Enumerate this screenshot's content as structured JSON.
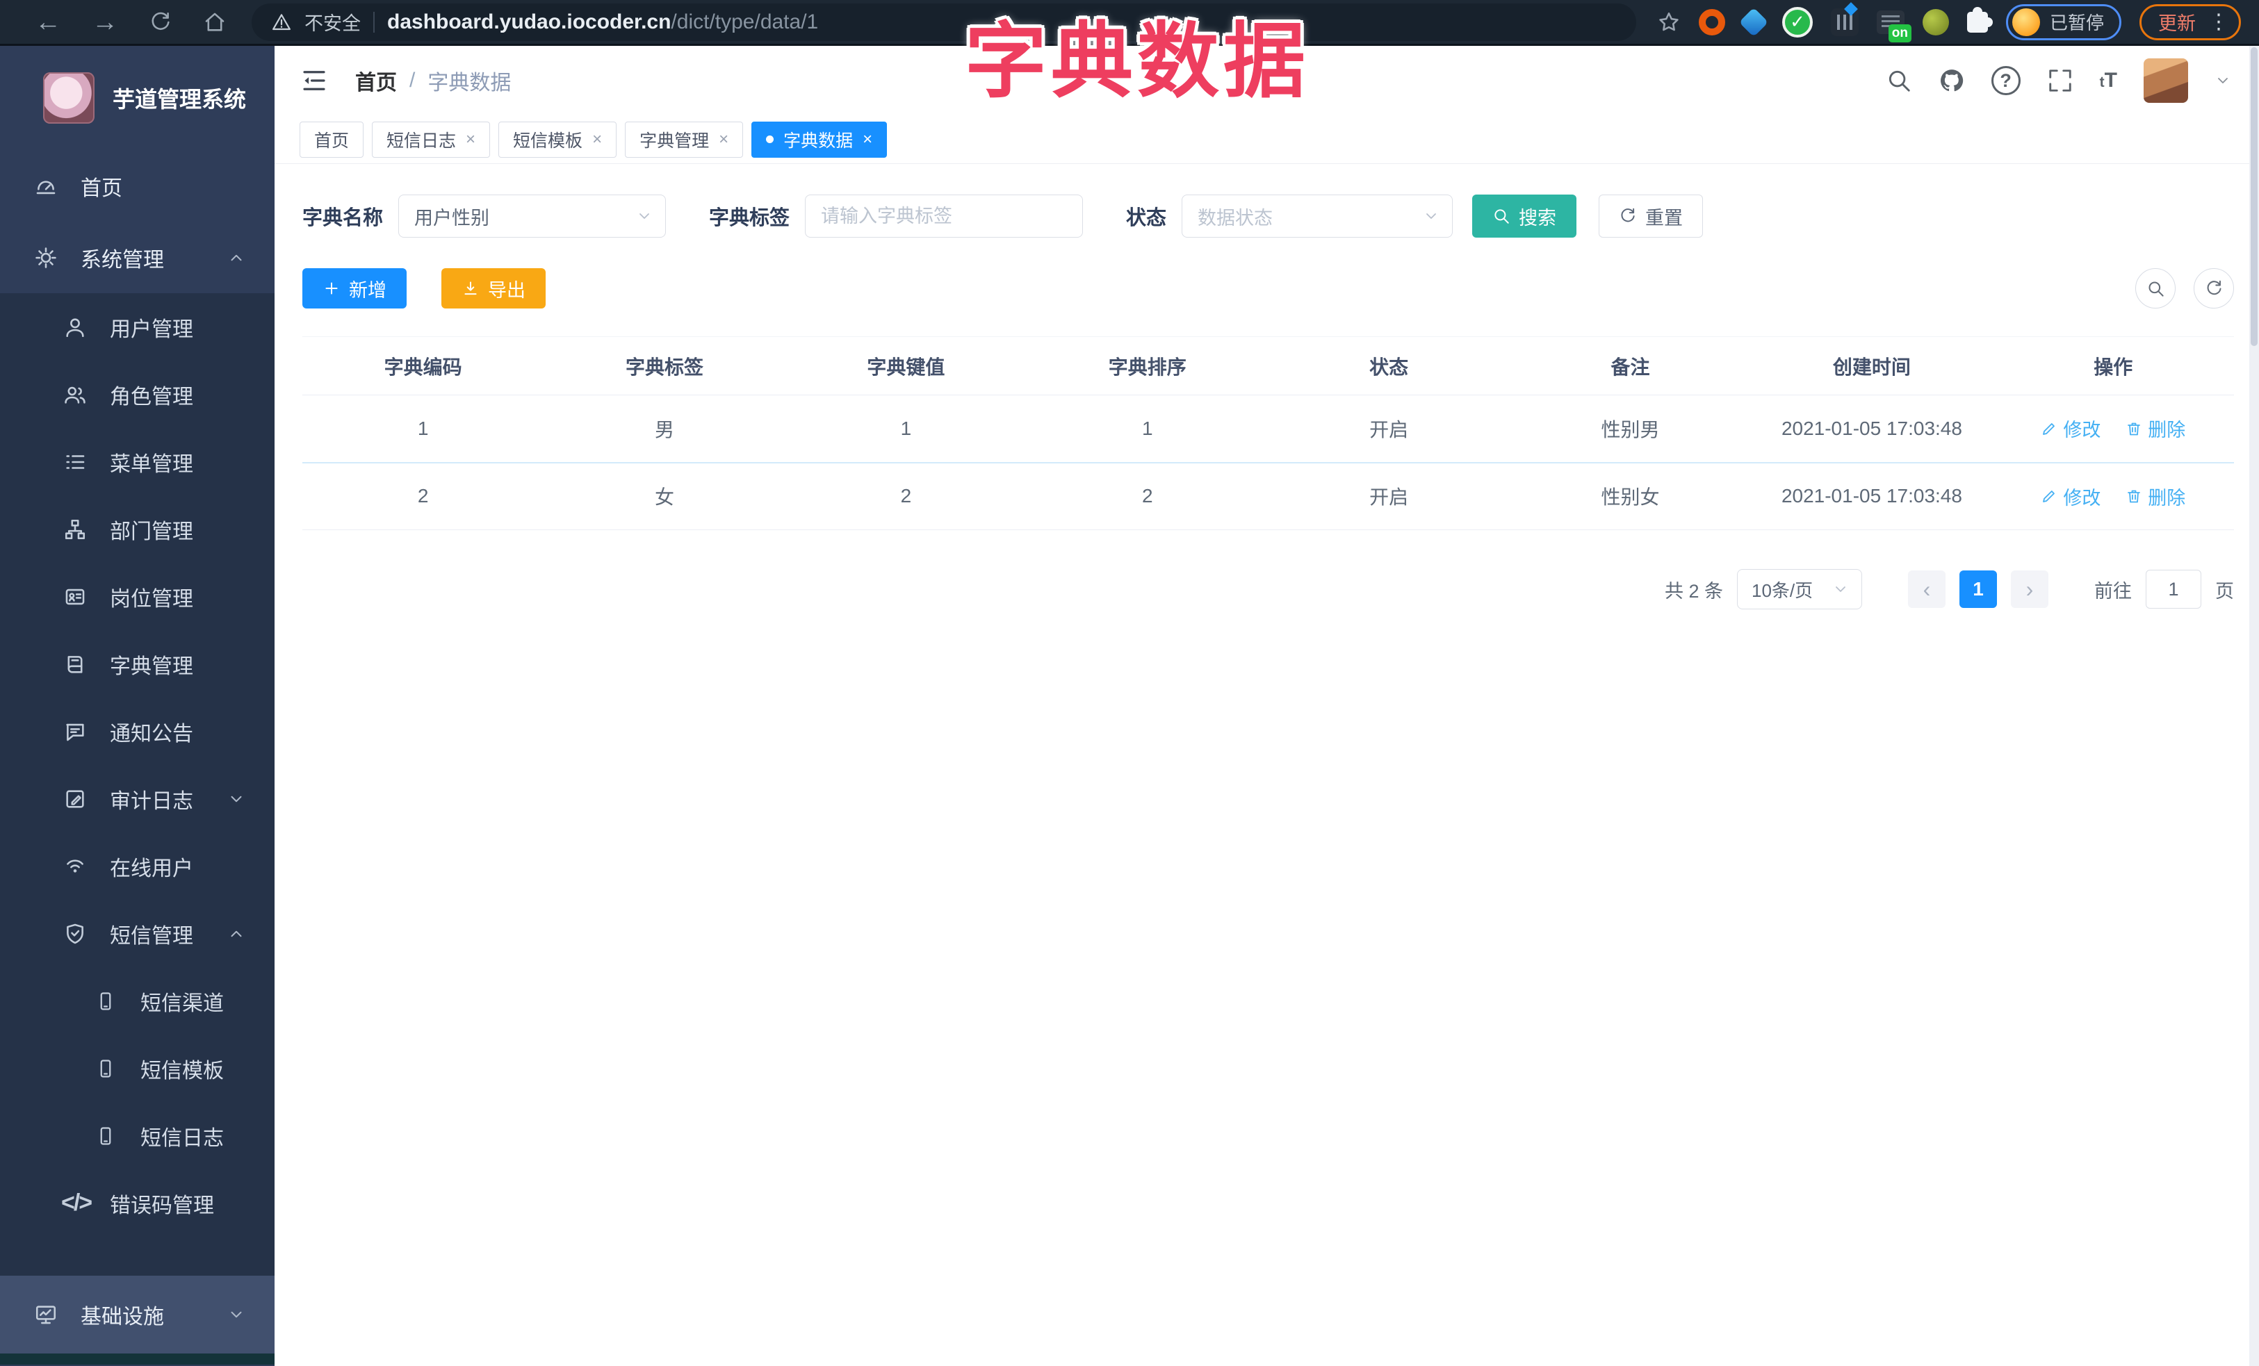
{
  "colors": {
    "accent": "#1890ff",
    "success_teal": "#2db5a3",
    "warning_yellow": "#f9a814",
    "overlay_pink": "#ee3e5f",
    "sidebar_bg": "#2f3d59",
    "submenu_bg": "#253248"
  },
  "overlay_title": "字典数据",
  "browser": {
    "security_chip": "不安全",
    "url_domain": "dashboard.yudao.iocoder.cn",
    "url_path": "/dict/type/data/1",
    "on_badge": "on",
    "paused_badge": "已暂停",
    "update_button": "更新"
  },
  "icons": {
    "back": "←",
    "forward": "→",
    "close": "×",
    "question": "?",
    "code": "</>",
    "check": "✓",
    "kebab": "⋮",
    "prev": "‹",
    "next": "›",
    "caret": "▾",
    "star": "☆",
    "warning": "⚠",
    "font_large": "T",
    "font_small": "t"
  },
  "sidebar": {
    "app_title": "芋道管理系统",
    "items": [
      {
        "label": "首页"
      },
      {
        "label": "系统管理"
      },
      {
        "label": "用户管理"
      },
      {
        "label": "角色管理"
      },
      {
        "label": "菜单管理"
      },
      {
        "label": "部门管理"
      },
      {
        "label": "岗位管理"
      },
      {
        "label": "字典管理"
      },
      {
        "label": "通知公告"
      },
      {
        "label": "审计日志"
      },
      {
        "label": "在线用户"
      },
      {
        "label": "短信管理"
      },
      {
        "label": "短信渠道"
      },
      {
        "label": "短信模板"
      },
      {
        "label": "短信日志"
      },
      {
        "label": "错误码管理"
      },
      {
        "label": "基础设施"
      }
    ]
  },
  "navbar": {
    "breadcrumb_home": "首页",
    "breadcrumb_sep": "/",
    "breadcrumb_current": "字典数据"
  },
  "tabs": [
    {
      "label": "首页"
    },
    {
      "label": "短信日志"
    },
    {
      "label": "短信模板"
    },
    {
      "label": "字典管理"
    },
    {
      "label": "字典数据"
    }
  ],
  "filter": {
    "dict_name_label": "字典名称",
    "dict_name_value": "用户性别",
    "dict_label_label": "字典标签",
    "dict_label_placeholder": "请输入字典标签",
    "status_label": "状态",
    "status_placeholder": "数据状态",
    "search_button": "搜索",
    "reset_button": "重置"
  },
  "toolbar": {
    "add_button": "新增",
    "export_button": "导出"
  },
  "table": {
    "headers": [
      "字典编码",
      "字典标签",
      "字典键值",
      "字典排序",
      "状态",
      "备注",
      "创建时间",
      "操作"
    ],
    "rows": [
      {
        "code": "1",
        "label": "男",
        "value": "1",
        "sort": "1",
        "status": "开启",
        "remark": "性别男",
        "created": "2021-01-05 17:03:48"
      },
      {
        "code": "2",
        "label": "女",
        "value": "2",
        "sort": "2",
        "status": "开启",
        "remark": "性别女",
        "created": "2021-01-05 17:03:48"
      }
    ],
    "edit_label": "修改",
    "delete_label": "删除"
  },
  "pagination": {
    "total": "共 2 条",
    "page_size": "10条/页",
    "page": "1",
    "goto_label": "前往",
    "goto_value": "1",
    "page_unit": "页"
  }
}
